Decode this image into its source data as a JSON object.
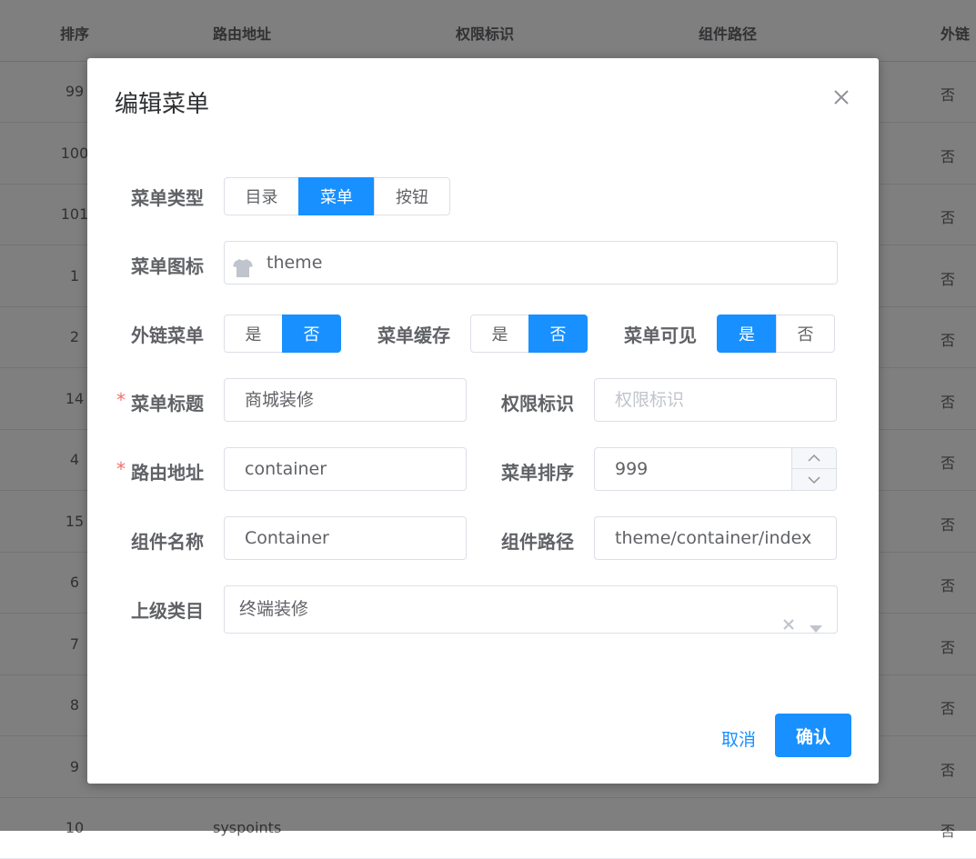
{
  "table": {
    "headers": [
      "排序",
      "路由地址",
      "权限标识",
      "组件路径",
      "外链"
    ],
    "rows": [
      {
        "sort": "99",
        "route": "",
        "ext": "否"
      },
      {
        "sort": "100",
        "route": "",
        "ext": "否"
      },
      {
        "sort": "101",
        "route": "",
        "ext": "否"
      },
      {
        "sort": "1",
        "route": "",
        "ext": "否"
      },
      {
        "sort": "2",
        "route": "",
        "ext": "否"
      },
      {
        "sort": "14",
        "route": "",
        "ext": "否"
      },
      {
        "sort": "4",
        "route": "",
        "ext": "否"
      },
      {
        "sort": "15",
        "route": "",
        "ext": "否"
      },
      {
        "sort": "6",
        "route": "",
        "ext": "否"
      },
      {
        "sort": "7",
        "route": "",
        "ext": "否"
      },
      {
        "sort": "8",
        "route": "",
        "ext": "否"
      },
      {
        "sort": "9",
        "route": "",
        "ext": "否"
      },
      {
        "sort": "10",
        "route": "syspoints",
        "ext": "否"
      }
    ]
  },
  "dialog": {
    "title": "编辑菜单",
    "close_icon": "close-icon",
    "menu_type": {
      "label": "菜单类型",
      "options": [
        "目录",
        "菜单",
        "按钮"
      ],
      "selected": "菜单"
    },
    "menu_icon": {
      "label": "菜单图标",
      "value": "theme",
      "icon": "shirt-icon"
    },
    "external": {
      "label": "外链菜单",
      "options": [
        "是",
        "否"
      ],
      "selected": "否"
    },
    "cache": {
      "label": "菜单缓存",
      "options": [
        "是",
        "否"
      ],
      "selected": "否"
    },
    "visible": {
      "label": "菜单可见",
      "options": [
        "是",
        "否"
      ],
      "selected": "是"
    },
    "menu_title": {
      "label": "菜单标题",
      "value": "商城装修",
      "required_mark": "*"
    },
    "permission": {
      "label": "权限标识",
      "placeholder": "权限标识"
    },
    "route": {
      "label": "路由地址",
      "value": "container",
      "required_mark": "*"
    },
    "sort": {
      "label": "菜单排序",
      "value": "999"
    },
    "component_name": {
      "label": "组件名称",
      "value": "Container"
    },
    "component_path": {
      "label": "组件路径",
      "value": "theme/container/index"
    },
    "parent": {
      "label": "上级类目",
      "value": "终端装修"
    },
    "cancel_label": "取消",
    "confirm_label": "确认"
  },
  "colors": {
    "primary": "#1890ff",
    "required": "#f56c6c"
  }
}
